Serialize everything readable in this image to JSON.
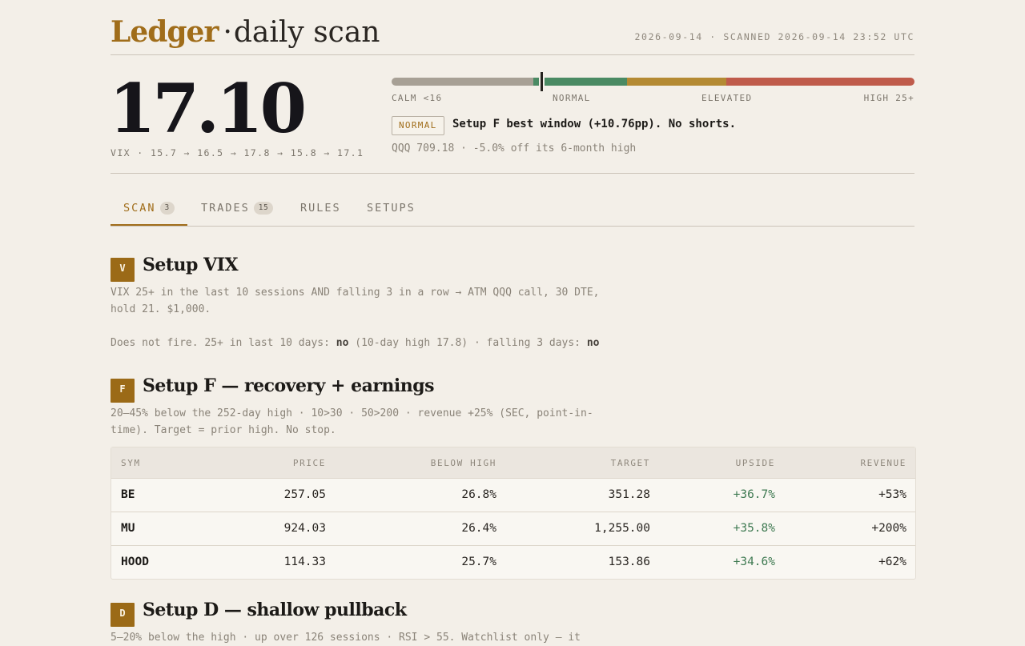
{
  "header": {
    "logo": "Ledger",
    "separator": "·",
    "subtitle": "daily scan",
    "scanned": "2026-09-14 · SCANNED 2026-09-14 23:52 UTC"
  },
  "hero": {
    "vix_value": "17.10",
    "vix_trail": "VIX · 15.7 → 16.5 → 17.8 → 15.8 → 17.1",
    "gauge_level": 17.1,
    "gauge_colors": [
      "#a7a095",
      "#4a8a63",
      "#b48a33",
      "#bf5b4b"
    ],
    "zones": [
      "CALM <16",
      "NORMAL",
      "ELEVATED",
      "HIGH 25+"
    ],
    "regime_badge": "NORMAL",
    "headline": "Setup F best window (+10.76pp). No shorts.",
    "qqq_line": "QQQ 709.18 · -5.0% off its 6-month high"
  },
  "tabs": [
    {
      "label": "SCAN",
      "count": "3",
      "active": true
    },
    {
      "label": "TRADES",
      "count": "15",
      "active": false
    },
    {
      "label": "RULES",
      "count": null,
      "active": false
    },
    {
      "label": "SETUPS",
      "count": null,
      "active": false
    }
  ],
  "setups": {
    "vix": {
      "letter": "V",
      "title": "Setup VIX",
      "rule": "VIX 25+ in the last 10 sessions AND falling 3 in a row → ATM QQQ call, 30 DTE, hold 21. $1,000.",
      "status_prefix": "Does not fire. 25+ in last 10 days: ",
      "status_val1": "no",
      "status_mid": " (10-day high 17.8) · falling 3 days: ",
      "status_val2": "no"
    },
    "f": {
      "letter": "F",
      "title": "Setup F — recovery + earnings",
      "rule": "20–45% below the 252-day high · 10>30 · 50>200 · revenue +25% (SEC, point-in-time). Target = prior high. No stop.",
      "columns": [
        "SYM",
        "PRICE",
        "BELOW HIGH",
        "TARGET",
        "UPSIDE",
        "REVENUE"
      ],
      "rows": [
        {
          "sym": "BE",
          "price": "257.05",
          "below": "26.8%",
          "target": "351.28",
          "upside": "+36.7%",
          "revenue": "+53%"
        },
        {
          "sym": "MU",
          "price": "924.03",
          "below": "26.4%",
          "target": "1,255.00",
          "upside": "+35.8%",
          "revenue": "+200%"
        },
        {
          "sym": "HOOD",
          "price": "114.33",
          "below": "25.7%",
          "target": "153.86",
          "upside": "+34.6%",
          "revenue": "+62%"
        }
      ]
    },
    "d": {
      "letter": "D",
      "title": "Setup D — shallow pullback",
      "rule": "5–20% below the high · up over 126 sessions · RSI > 55. Watchlist only — it"
    }
  },
  "colors": {
    "accent": "#a06d1a",
    "positive": "#3f7a52",
    "background": "#f3efe8"
  }
}
